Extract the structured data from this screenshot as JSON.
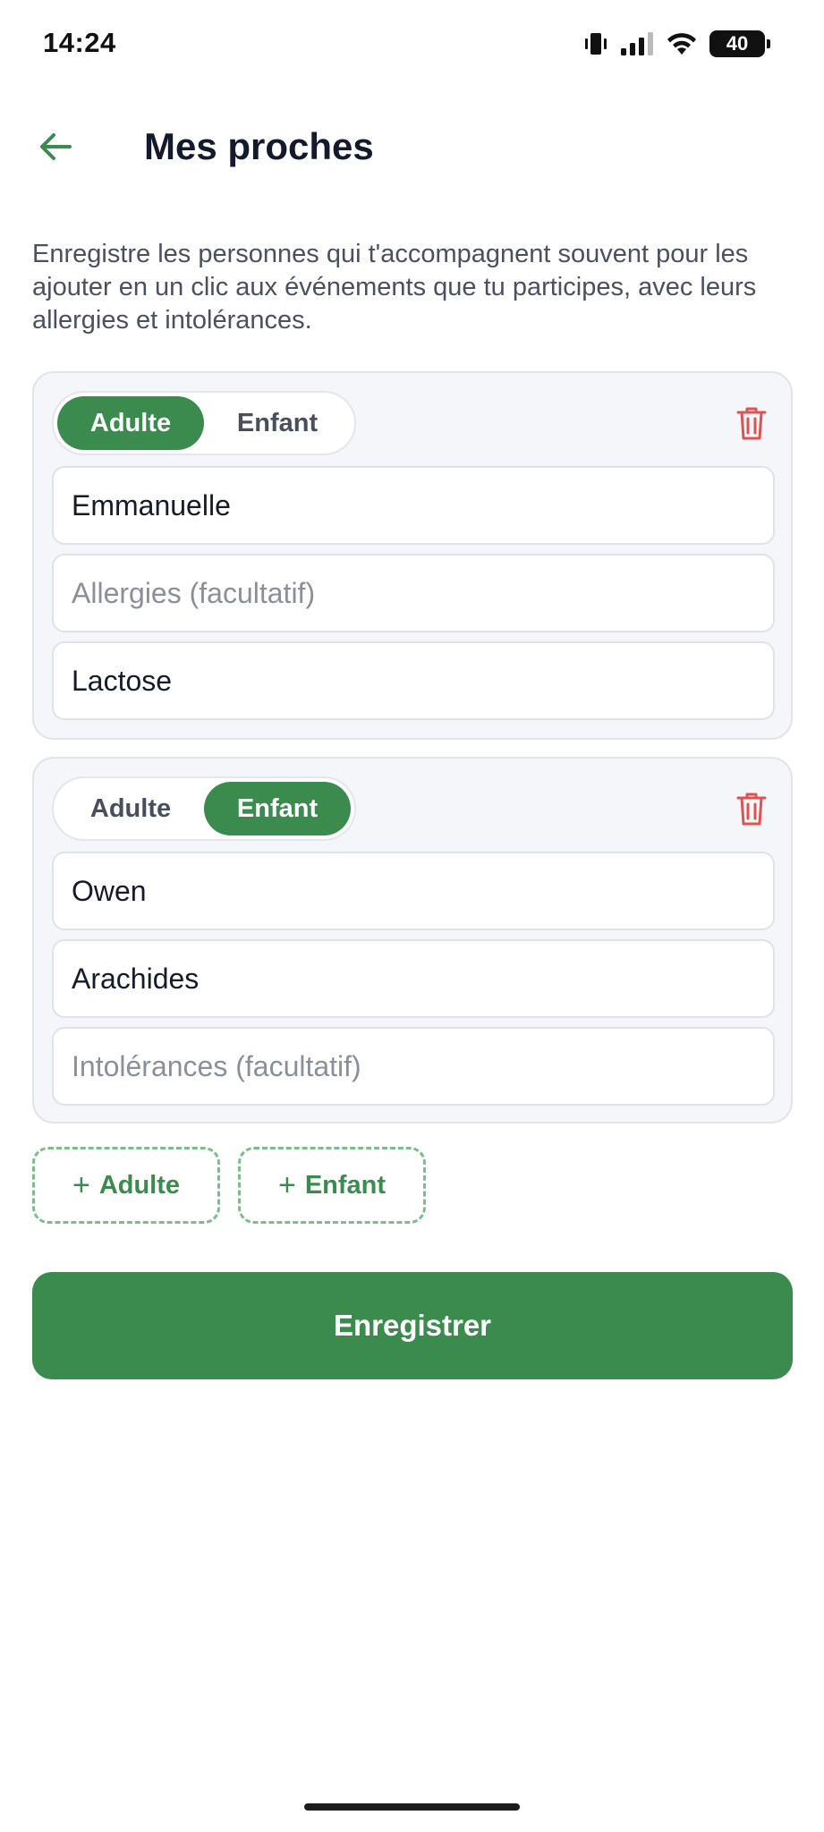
{
  "status_bar": {
    "time": "14:24",
    "battery": "40"
  },
  "header": {
    "title": "Mes proches",
    "back_icon": "arrow-left-icon"
  },
  "intro_text": "Enregistre les personnes qui t'accompagnent souvent pour les ajouter en un clic aux événements que tu participes, avec leurs allergies et intolérances.",
  "people": [
    {
      "type_options": [
        "Adulte",
        "Enfant"
      ],
      "selected_type": "Adulte",
      "name": {
        "value": "Emmanuelle",
        "placeholder": ""
      },
      "allergies": {
        "value": "",
        "placeholder": "Allergies (facultatif)"
      },
      "intolerances": {
        "value": "Lactose",
        "placeholder": ""
      }
    },
    {
      "type_options": [
        "Adulte",
        "Enfant"
      ],
      "selected_type": "Enfant",
      "name": {
        "value": "Owen",
        "placeholder": ""
      },
      "allergies": {
        "value": "Arachides",
        "placeholder": ""
      },
      "intolerances": {
        "value": "",
        "placeholder": "Intolérances (facultatif)"
      }
    }
  ],
  "add_buttons": {
    "adult": "Adulte",
    "child": "Enfant",
    "plus": "+"
  },
  "save_label": "Enregistrer",
  "colors": {
    "accent": "#3b8b4f",
    "delete": "#e05252",
    "dashed_border": "#7cbd8c"
  }
}
